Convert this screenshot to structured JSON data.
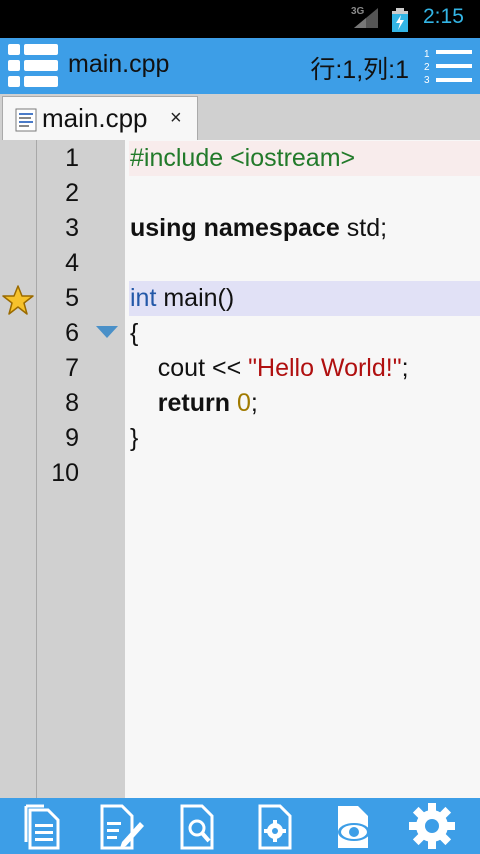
{
  "status_bar": {
    "network": "3G",
    "time": "2:15"
  },
  "toolbar": {
    "title": "main.cpp",
    "cursor_position": "行:1,列:1"
  },
  "tabs": [
    {
      "label": "main.cpp",
      "close": "×"
    }
  ],
  "editor": {
    "line_numbers": [
      "1",
      "2",
      "3",
      "4",
      "5",
      "6",
      "7",
      "8",
      "9",
      "10"
    ],
    "lines": [
      [
        {
          "t": "#include <iostream>",
          "c": "pp"
        }
      ],
      [],
      [
        {
          "t": "using namespace",
          "c": "kw"
        },
        {
          "t": " std;",
          "c": ""
        }
      ],
      [],
      [
        {
          "t": "int",
          "c": "ty"
        },
        {
          "t": " main()",
          "c": ""
        }
      ],
      [
        {
          "t": "{",
          "c": ""
        }
      ],
      [
        {
          "t": "    cout << ",
          "c": ""
        },
        {
          "t": "\"Hello World!\"",
          "c": "str"
        },
        {
          "t": ";",
          "c": ""
        }
      ],
      [
        {
          "t": "    ",
          "c": ""
        },
        {
          "t": "return",
          "c": "kw"
        },
        {
          "t": " ",
          "c": ""
        },
        {
          "t": "0",
          "c": "num"
        },
        {
          "t": ";",
          "c": ""
        }
      ],
      [
        {
          "t": "}",
          "c": ""
        }
      ],
      []
    ],
    "bookmarked_line": 5,
    "folded_line": 6,
    "highlighted_lines": [
      1,
      5
    ]
  },
  "bottom_bar": {
    "buttons": [
      "new-file",
      "edit-file",
      "search-file",
      "file-settings",
      "preview",
      "settings"
    ]
  },
  "colors": {
    "accent": "#3d9ee7",
    "status_time": "#33b5e5",
    "gutter": "#d0d0d0"
  }
}
